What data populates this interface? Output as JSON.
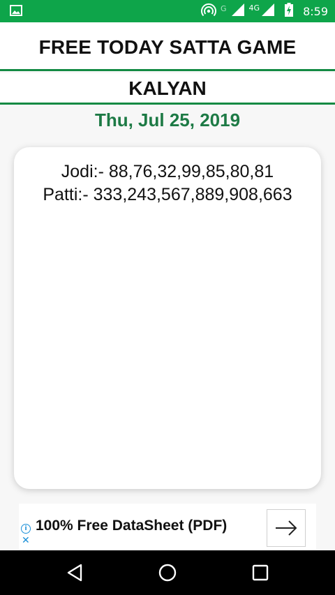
{
  "status_bar": {
    "time": "8:59",
    "network_label": "4G",
    "secondary_network_label": "G",
    "icons": [
      "image-notification-icon",
      "hotspot-icon",
      "signal-icon",
      "battery-charging-icon"
    ],
    "background_color": "#0ea54a"
  },
  "header": {
    "title": "FREE TODAY SATTA GAME",
    "accent_color": "#138a43"
  },
  "market": {
    "name": "KALYAN",
    "date": "Thu, Jul 25, 2019",
    "date_color": "#1d7a45"
  },
  "result": {
    "jodi_line": "Jodi:- 88,76,32,99,85,80,81",
    "patti_line": "Patti:- 333,243,567,889,908,663"
  },
  "ad": {
    "text": "100% Free DataSheet (PDF)",
    "info_glyph": "i",
    "close_glyph": "✕",
    "icons": [
      "ad-info-icon",
      "ad-close-icon",
      "arrow-right-icon"
    ]
  },
  "nav_bar": {
    "icons": [
      "back-icon",
      "home-icon",
      "recents-icon"
    ]
  }
}
